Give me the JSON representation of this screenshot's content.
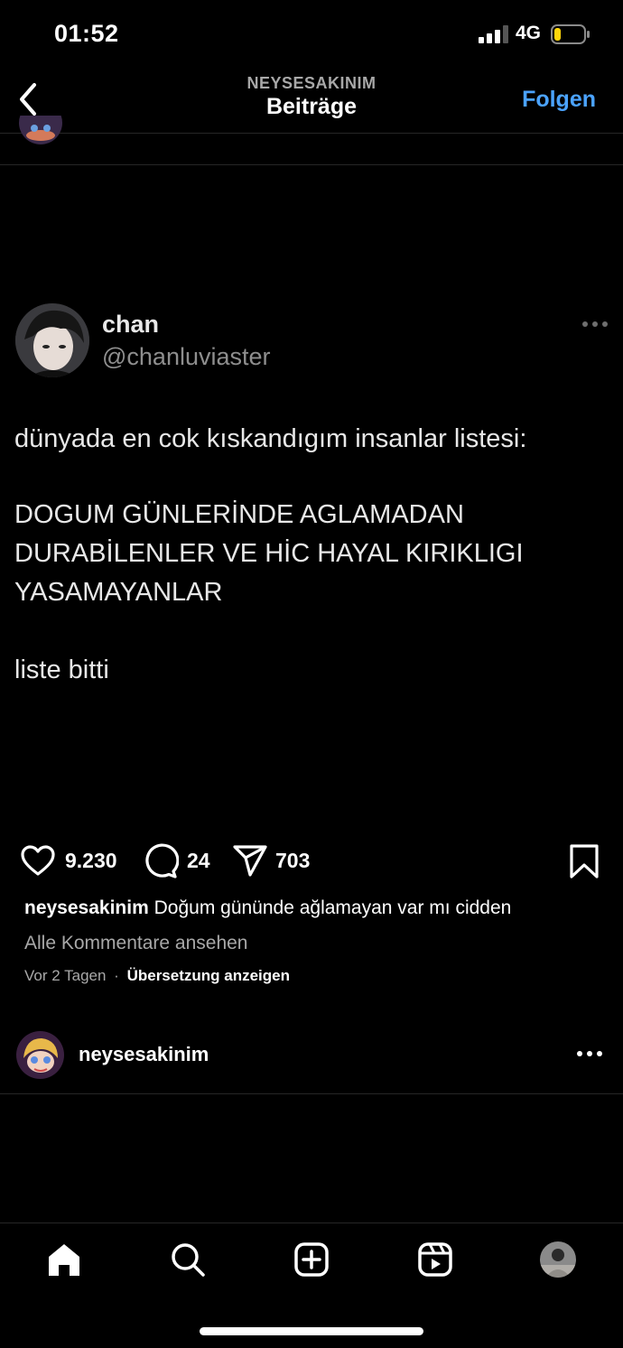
{
  "status_bar": {
    "time": "01:52",
    "network": "4G"
  },
  "header": {
    "username": "NEYSESAKINIM",
    "title": "Beiträge",
    "follow_label": "Folgen"
  },
  "tweet": {
    "display_name": "chan",
    "handle": "@chanluviaster",
    "lines": [
      "dünyada en cok kıskandıgım insanlar listesi:",
      "DOGUM GÜNLERİNDE AGLAMADAN",
      "DURABİLENLER VE HİC HAYAL KIRIKLIGI",
      "YASAMAYANLAR",
      "liste bitti"
    ]
  },
  "actions": {
    "likes": "9.230",
    "comments": "24",
    "shares": "703"
  },
  "caption": {
    "username": "neysesakinim",
    "text": "Doğum gününde ağlamayan var mı cidden"
  },
  "view_comments": "Alle Kommentare ansehen",
  "meta": {
    "age": "Vor 2 Tagen",
    "separator": "·",
    "translate": "Übersetzung anzeigen"
  },
  "next_post": {
    "username": "neysesakinim"
  },
  "colors": {
    "accent": "#4ba3ff",
    "background": "#000000",
    "secondary_text": "#a8a8a8"
  },
  "icons": {
    "back": "chevron-left-icon",
    "like": "heart-icon",
    "comment": "comment-icon",
    "share": "send-icon",
    "save": "bookmark-icon",
    "home": "home-icon",
    "search": "search-icon",
    "create": "plus-square-icon",
    "reels": "reels-icon"
  }
}
